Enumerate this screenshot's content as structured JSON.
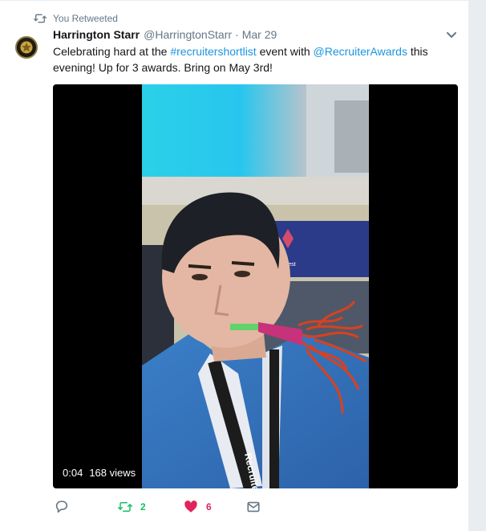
{
  "retweet_context": {
    "label": "You Retweeted",
    "icon": "retweet-icon"
  },
  "tweet": {
    "author": {
      "fullname": "Harrington Starr",
      "username": "@HarringtonStarr",
      "avatar_icon": "star-badge-icon"
    },
    "separator": "·",
    "timestamp": "Mar 29",
    "text": {
      "part1": "Celebrating hard at the ",
      "hashtag": "#recruitershortlist",
      "part2": " event with ",
      "mention": "@RecruiterAwards",
      "part3": " this evening! Up for 3 awards. Bring on May 3rd!"
    },
    "media": {
      "type": "video",
      "duration": "0:04",
      "views": "168 views",
      "banner_text": "NatWest",
      "lanyard_text": "Recruiter"
    },
    "actions": {
      "reply": {
        "icon": "reply-icon",
        "count": ""
      },
      "retweet": {
        "icon": "retweet-icon",
        "count": "2",
        "active": true,
        "color": "#17bf63"
      },
      "like": {
        "icon": "heart-icon",
        "count": "6",
        "active": true,
        "color": "#e0245e"
      },
      "dm": {
        "icon": "envelope-icon",
        "count": ""
      }
    }
  },
  "colors": {
    "link": "#1b95e0",
    "secondary_text": "#657786",
    "border": "#e6ecf0"
  }
}
